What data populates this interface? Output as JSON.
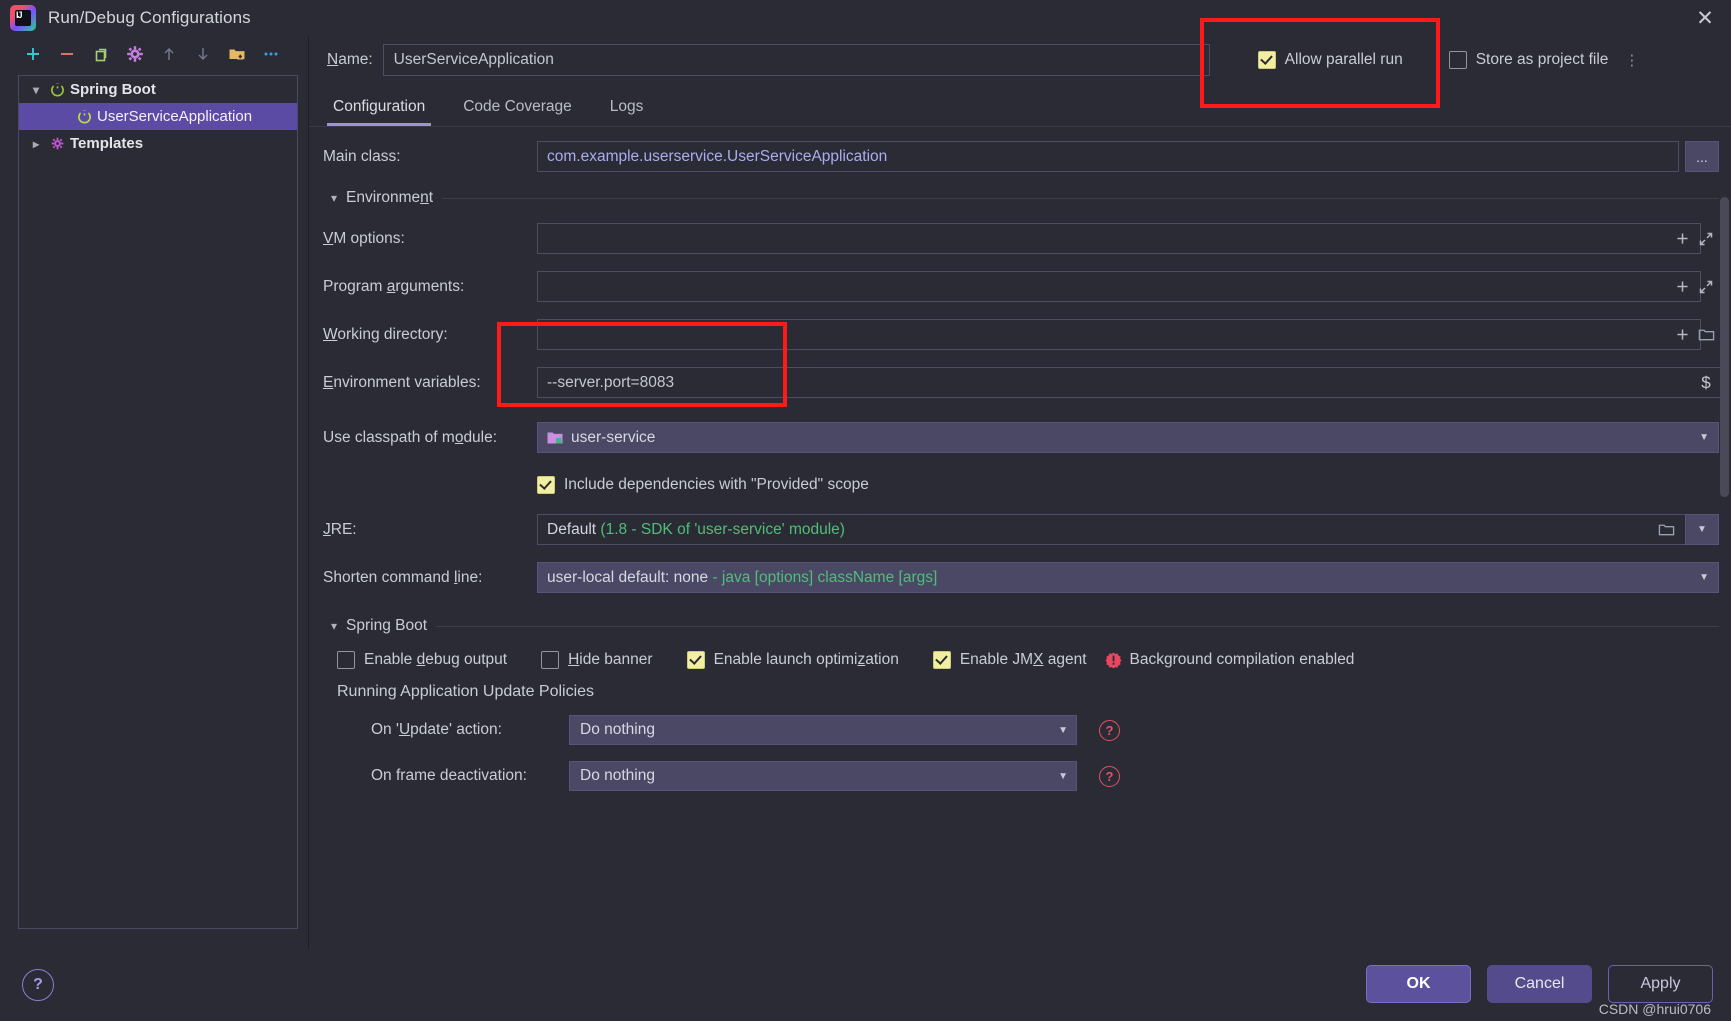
{
  "window": {
    "title": "Run/Debug Configurations",
    "logo_icon": "intellij-idea-logo",
    "close_icon": "close-icon"
  },
  "left_toolbar": {
    "items": [
      {
        "name": "add-configuration-button",
        "icon": "plus-icon",
        "glyph": "+",
        "color": "#39c6d4"
      },
      {
        "name": "remove-configuration-button",
        "icon": "minus-icon",
        "glyph": "–",
        "color": "#e07a6e"
      },
      {
        "name": "copy-configuration-button",
        "icon": "copy-icon",
        "glyph": "⧉",
        "color": "#a5d06a"
      },
      {
        "name": "edit-templates-button",
        "icon": "gear-icon",
        "glyph": "⚙",
        "color": "#c47fe0"
      },
      {
        "name": "move-up-button",
        "icon": "arrow-up-icon",
        "glyph": "↑",
        "color": "#6e717e"
      },
      {
        "name": "move-down-button",
        "icon": "arrow-down-icon",
        "glyph": "↓",
        "color": "#6e717e"
      },
      {
        "name": "new-folder-button",
        "icon": "folder-add-icon",
        "glyph": "Ὄ1",
        "color": "#e0b24f"
      },
      {
        "name": "more-options-button",
        "icon": "more-horizontal-icon",
        "glyph": "⋯",
        "color": "#3f9ee0"
      }
    ]
  },
  "tree": {
    "nodes": [
      {
        "label": "Spring Boot",
        "icon": "spring-boot-run-icon",
        "expanded": true,
        "selected": false,
        "level": 0
      },
      {
        "label": "UserServiceApplication",
        "icon": "spring-boot-run-icon",
        "expanded": false,
        "selected": true,
        "level": 1
      },
      {
        "label": "Templates",
        "icon": "gear-icon",
        "expanded": false,
        "selected": false,
        "level": 0
      }
    ]
  },
  "name_row": {
    "label": "Name:",
    "label_underline_char": "N",
    "value": "UserServiceApplication",
    "allow_parallel_run": {
      "label": "Allow parallel run",
      "checked": true
    },
    "store_as_project_file": {
      "label": "Store as project file",
      "checked": false
    },
    "overflow_icon": "more-vertical-icon"
  },
  "tabs": {
    "items": [
      {
        "label": "Configuration",
        "active": true
      },
      {
        "label": "Code Coverage",
        "active": false
      },
      {
        "label": "Logs",
        "active": false
      }
    ]
  },
  "form": {
    "main_class": {
      "label": "Main class:",
      "value": "com.example.userservice.UserServiceApplication",
      "browse_button": "..."
    },
    "environment_section": {
      "label": "Environment",
      "expanded": true
    },
    "vm_options": {
      "label": "VM options:",
      "value": "",
      "add_icon": "plus-icon",
      "expand_icon": "expand-icon"
    },
    "program_arguments": {
      "label": "Program arguments:",
      "value": "",
      "add_icon": "plus-icon",
      "expand_icon": "expand-icon"
    },
    "working_directory": {
      "label": "Working directory:",
      "value": "",
      "add_icon": "plus-icon",
      "browse_icon": "folder-icon"
    },
    "environment_variables": {
      "label": "Environment variables:",
      "value": "--server.port=8083",
      "macro_icon": "dollar-icon"
    },
    "use_classpath_of_module": {
      "label": "Use classpath of module:",
      "value": "user-service",
      "icon": "module-icon"
    },
    "include_provided": {
      "label": "Include dependencies with \"Provided\" scope",
      "checked": true
    },
    "jre": {
      "label": "JRE:",
      "value": "Default ",
      "value_hint": "(1.8 - SDK of 'user-service' module)",
      "browse_icon": "folder-icon"
    },
    "shorten_command_line": {
      "label": "Shorten command line:",
      "value": "user-local default: none ",
      "value_hint": "- java [options] className [args]"
    },
    "spring_boot_section": {
      "label": "Spring Boot",
      "expanded": true
    },
    "spring_boot_options": [
      {
        "label": "Enable debug output",
        "checked": false,
        "name": "enable-debug-output-checkbox"
      },
      {
        "label": "Hide banner",
        "checked": false,
        "name": "hide-banner-checkbox"
      },
      {
        "label": "Enable launch optimization",
        "checked": true,
        "name": "enable-launch-optimization-checkbox"
      },
      {
        "label": "Enable JMX agent",
        "checked": true,
        "name": "enable-jmx-agent-checkbox"
      }
    ],
    "background_compilation": {
      "label": "Background compilation enabled",
      "icon": "warning-icon"
    },
    "update_policies_section": {
      "label": "Running Application Update Policies"
    },
    "on_update_action": {
      "label": "On 'Update' action:",
      "value": "Do nothing",
      "help_icon": "help-icon"
    },
    "on_frame_deactivation": {
      "label": "On frame deactivation:",
      "value": "Do nothing",
      "help_icon": "help-icon"
    }
  },
  "highlights": [
    {
      "name": "allow-parallel-run-highlight",
      "color": "#ff1a1a"
    },
    {
      "name": "environment-variables-highlight",
      "color": "#ff1a1a"
    }
  ],
  "footer": {
    "help_button": {
      "label": "?",
      "name": "help-button"
    },
    "ok": "OK",
    "cancel": "Cancel",
    "apply": "Apply",
    "watermark": "CSDN @hrui0706"
  }
}
